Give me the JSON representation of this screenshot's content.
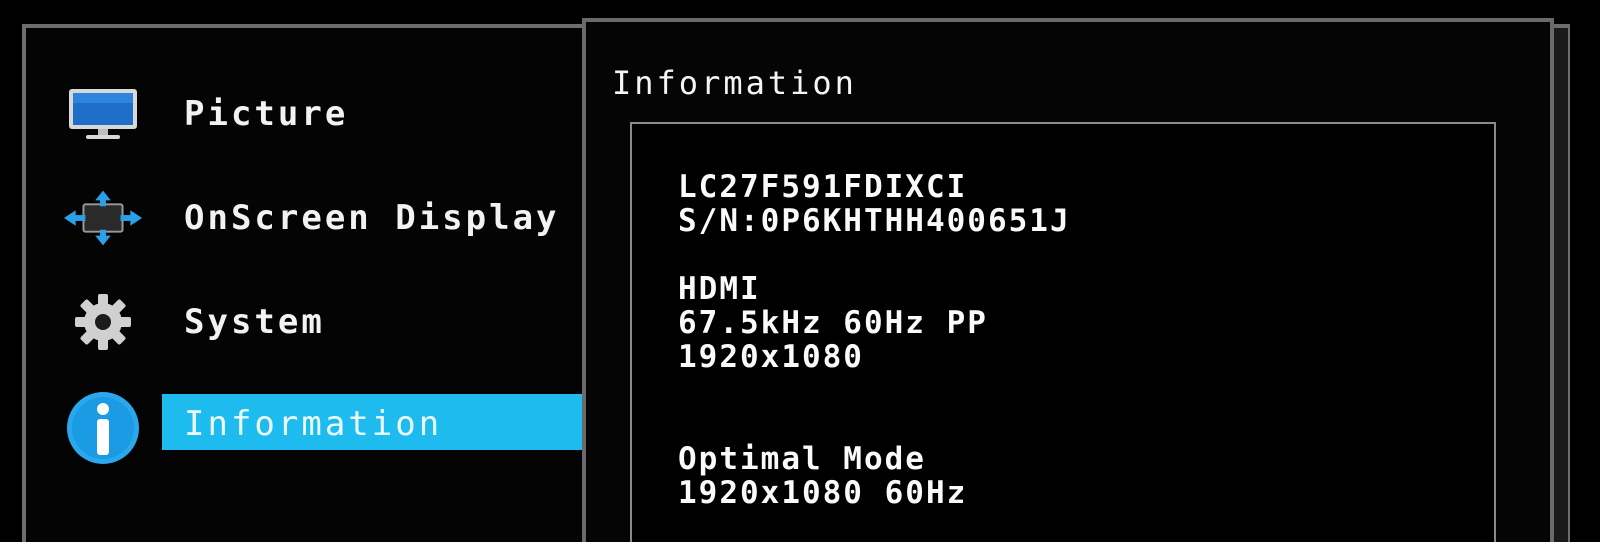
{
  "menu": {
    "items": [
      {
        "label": "Picture",
        "icon": "monitor-icon",
        "selected": false
      },
      {
        "label": "OnScreen Display",
        "icon": "move-arrows-icon",
        "selected": false
      },
      {
        "label": "System",
        "icon": "gear-icon",
        "selected": false
      },
      {
        "label": "Information",
        "icon": "info-icon",
        "selected": true
      }
    ]
  },
  "panel": {
    "title": "Information",
    "model": "LC27F591FDIXCI",
    "serial": "S/N:0P6KHTHH400651J",
    "input_source": "HDMI",
    "frequency": "67.5kHz 60Hz PP",
    "resolution": "1920x1080",
    "optimal_mode_label": "Optimal Mode",
    "optimal_mode_value": "1920x1080 60Hz"
  },
  "colors": {
    "highlight": "#1ebcee",
    "icon_blue": "#1e86d4",
    "frame": "#6d6d6d"
  }
}
